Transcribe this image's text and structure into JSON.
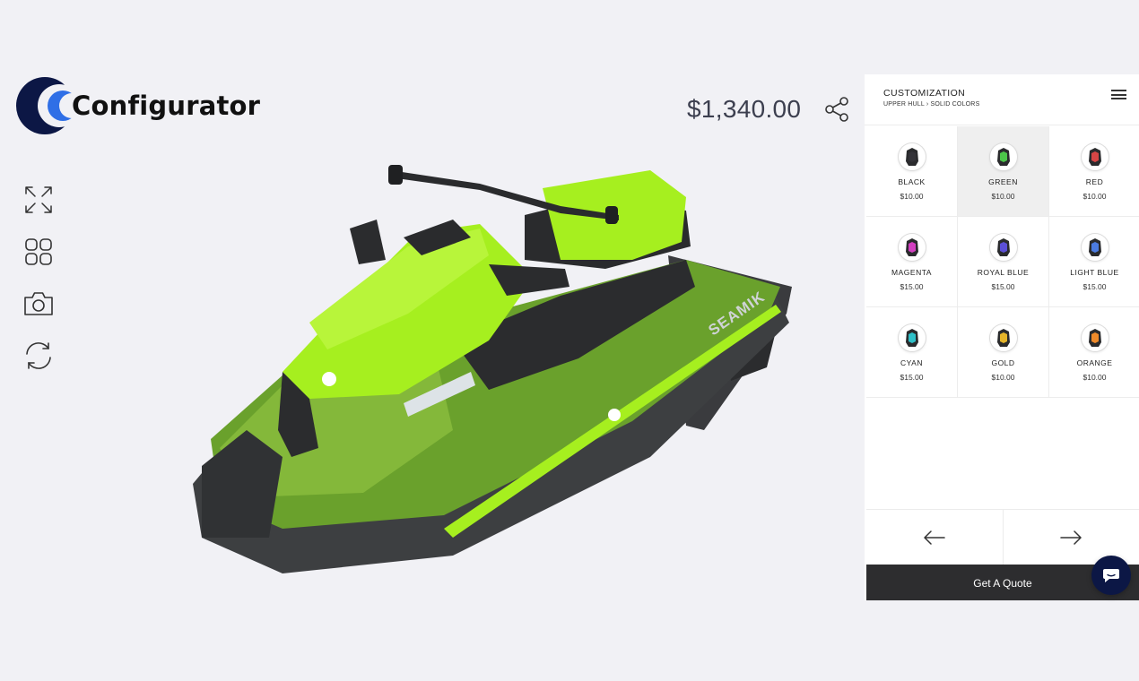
{
  "brand": {
    "name": "Configurator"
  },
  "price": "$1,340.00",
  "toolbar": {
    "items": [
      {
        "name": "fullscreen-icon"
      },
      {
        "name": "grid-view-icon"
      },
      {
        "name": "camera-icon"
      },
      {
        "name": "rotate-icon"
      }
    ]
  },
  "product": {
    "logo_text": "SEAMIK"
  },
  "panel": {
    "title": "CUSTOMIZATION",
    "breadcrumb": "UPPER HULL › SOLID COLORS",
    "colors": [
      {
        "name": "BLACK",
        "price": "$10.00",
        "hex": "#333338"
      },
      {
        "name": "GREEN",
        "price": "$10.00",
        "hex": "#4cc64a",
        "selected": true
      },
      {
        "name": "RED",
        "price": "$10.00",
        "hex": "#d64545"
      },
      {
        "name": "MAGENTA",
        "price": "$15.00",
        "hex": "#d23fc0"
      },
      {
        "name": "ROYAL BLUE",
        "price": "$15.00",
        "hex": "#5b4fd6"
      },
      {
        "name": "LIGHT BLUE",
        "price": "$15.00",
        "hex": "#4b7be0"
      },
      {
        "name": "CYAN",
        "price": "$15.00",
        "hex": "#2fc0c8"
      },
      {
        "name": "GOLD",
        "price": "$10.00",
        "hex": "#e5b52a"
      },
      {
        "name": "ORANGE",
        "price": "$10.00",
        "hex": "#ee8a2a"
      }
    ],
    "quote_label": "Get A Quote"
  },
  "colors": {
    "accent": "#a6ef1f",
    "hull": "#6aa12c",
    "button": "#2d2d2f",
    "chat": "#0c1745"
  }
}
